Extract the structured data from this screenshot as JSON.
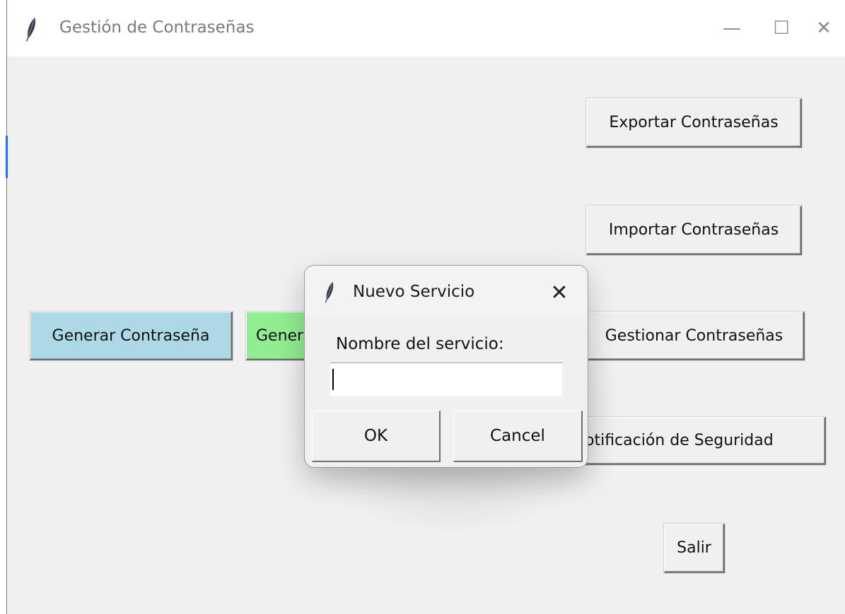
{
  "window": {
    "title": "Gestión de Contraseñas",
    "controls": {
      "minimize": "—",
      "maximize": "☐",
      "close": "✕"
    }
  },
  "main": {
    "generate_button": "Generar Contraseña",
    "green_button_visible": "Gener",
    "export_button": "Exportar Contraseñas",
    "import_button": "Importar Contraseñas",
    "manage_button": "Gestionar Contraseñas",
    "notify_button_visible": "otificación de Seguridad",
    "exit_button": "Salir"
  },
  "dialog": {
    "title": "Nuevo Servicio",
    "close": "✕",
    "label": "Nombre del servicio:",
    "input_value": "",
    "ok": "OK",
    "cancel": "Cancel"
  },
  "colors": {
    "blue_button": "#add8e6",
    "green_button": "#90ee90",
    "background": "#f0f0f0"
  },
  "icons": {
    "app": "feather-icon"
  }
}
